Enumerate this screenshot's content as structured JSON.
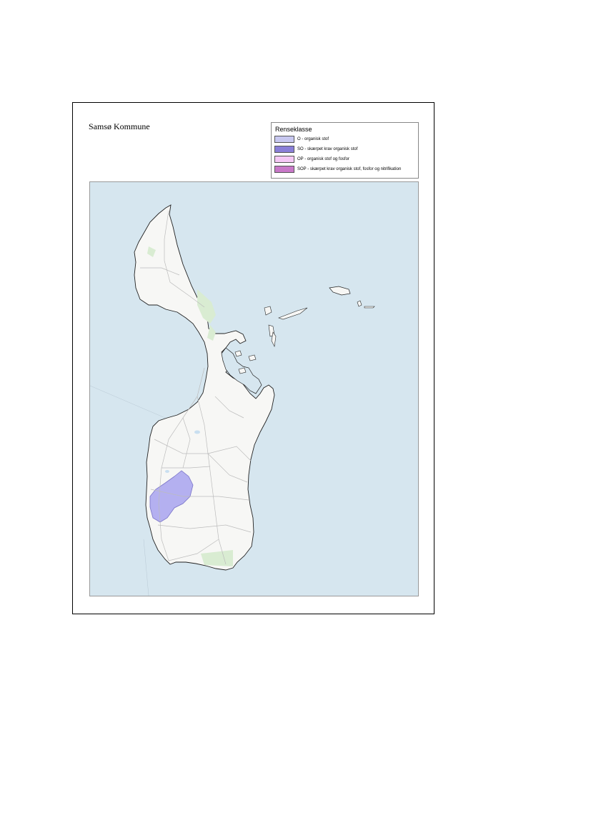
{
  "map": {
    "title": "Samsø Kommune",
    "legend": {
      "title": "Renseklasse",
      "items": [
        {
          "label": "O - organisk stof",
          "color": "#c8c8f0"
        },
        {
          "label": "SO - skærpet krav organisk stof",
          "color": "#8a7fd8"
        },
        {
          "label": "OP - organisk stof og fosfor",
          "color": "#f5c8f5"
        },
        {
          "label": "SOP - skærpet krav organisk stof, fosfor og nitrifikation",
          "color": "#c878c8"
        }
      ]
    },
    "colors": {
      "sea": "#d6e6ef",
      "land": "#f7f7f5",
      "forest": "#d9ecd2",
      "catchment": "#b4b0f0"
    }
  }
}
